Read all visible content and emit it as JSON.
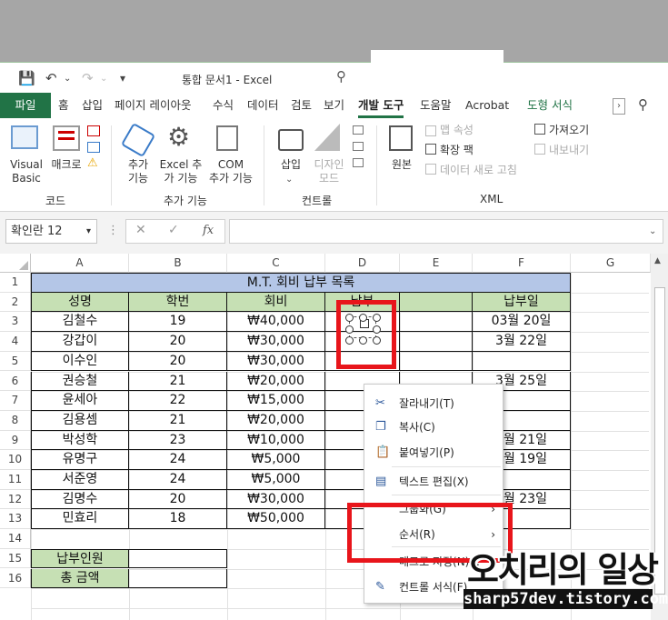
{
  "title_bar": {
    "doc_title": "통합 문서1  -  Excel"
  },
  "tabs": [
    {
      "label": "파일"
    },
    {
      "label": "홈"
    },
    {
      "label": "삽입"
    },
    {
      "label": "페이지 레이아웃"
    },
    {
      "label": "수식"
    },
    {
      "label": "데이터"
    },
    {
      "label": "검토"
    },
    {
      "label": "보기"
    },
    {
      "label": "개발 도구"
    },
    {
      "label": "도움말"
    },
    {
      "label": "Acrobat"
    },
    {
      "label": "도형 서식"
    }
  ],
  "ribbon": {
    "visual_basic": "Visual\nBasic",
    "macro": "매크로",
    "group_code": "코드",
    "addins": "추가\n기능",
    "excel_addins": "Excel 추\n가 기능",
    "com_addins": "COM\n추가 기능",
    "group_addins": "추가 기능",
    "insert": "삽입",
    "design_mode": "디자인\n모드",
    "group_controls": "컨트롤",
    "source": "원본",
    "map_props": "맵 속성",
    "expansion_pack": "확장 팩",
    "refresh_data": "데이터 새로 고침",
    "import": "가져오기",
    "export": "내보내기",
    "group_xml": "XML"
  },
  "formula_bar": {
    "name_box": "확인란 12",
    "fx": "fx",
    "formula": ""
  },
  "columns": [
    "A",
    "B",
    "C",
    "D",
    "E",
    "F",
    "G"
  ],
  "rows": [
    "1",
    "2",
    "3",
    "4",
    "5",
    "6",
    "7",
    "8",
    "9",
    "10",
    "11",
    "12",
    "13",
    "14",
    "15",
    "16"
  ],
  "table": {
    "title": "M.T. 회비 납부 목록",
    "headers": [
      "성명",
      "학번",
      "회비",
      "납부",
      "",
      "납부일"
    ],
    "data": [
      [
        "김철수",
        "19",
        "₩40,000",
        "",
        "",
        "03월 20일"
      ],
      [
        "강갑이",
        "20",
        "₩30,000",
        "",
        "",
        "3월 22일"
      ],
      [
        "이수인",
        "20",
        "₩30,000",
        "",
        "",
        ""
      ],
      [
        "권승철",
        "21",
        "₩20,000",
        "",
        "",
        "3월 25일"
      ],
      [
        "윤세아",
        "22",
        "₩15,000",
        "",
        "",
        ""
      ],
      [
        "김용셈",
        "21",
        "₩20,000",
        "",
        "",
        ""
      ],
      [
        "박성학",
        "23",
        "₩10,000",
        "",
        "",
        "3월 21일"
      ],
      [
        "유명구",
        "24",
        "₩5,000",
        "",
        "",
        "3월 19일"
      ],
      [
        "서준영",
        "24",
        "₩5,000",
        "",
        "",
        ""
      ],
      [
        "김명수",
        "20",
        "₩30,000",
        "",
        "",
        "3월 23일"
      ],
      [
        "민효리",
        "18",
        "₩50,000",
        "",
        "",
        ""
      ]
    ],
    "summary": [
      "납부인원",
      "총 금액"
    ]
  },
  "context_menu": {
    "cut": "잘라내기(T)",
    "copy": "복사(C)",
    "paste": "붙여넣기(P)",
    "edit_text": "텍스트 편집(X)",
    "group": "그룹화(G)",
    "order": "순서(R)",
    "assign_macro": "매크로 지정(N)...",
    "format_control": "컨트롤 서식(F)..."
  },
  "watermark": {
    "title": "오치리의 일상",
    "url": "sharp57dev.tistory.com"
  },
  "colors": {
    "excel_green": "#217346",
    "header_fill": "#c6e0b4",
    "title_fill": "#b4c6e7",
    "highlight": "#e8151b"
  }
}
